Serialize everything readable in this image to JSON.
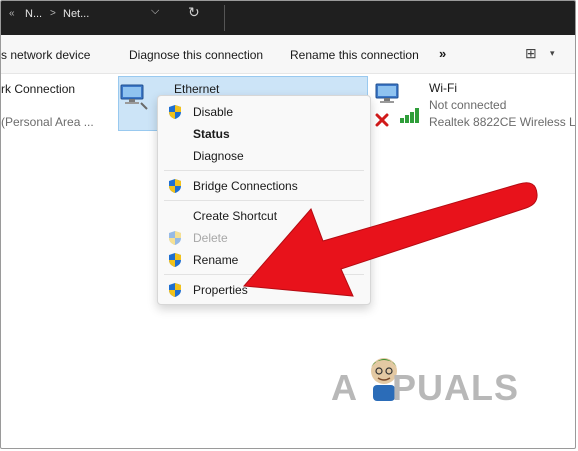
{
  "breadcrumb": {
    "back": "«",
    "seg1": "N...",
    "sep": ">",
    "seg2": "Net...",
    "chevron": "⌵",
    "refresh": "↻"
  },
  "commands": {
    "rename_device_partial": "s network device",
    "diagnose": "Diagnose this connection",
    "rename_connection": "Rename this connection",
    "more": "»",
    "view": "⊞",
    "view_dropdown": "▾"
  },
  "connections": {
    "left": {
      "name": "rk Connection",
      "subtitle": "(Personal Area ..."
    },
    "ethernet": {
      "name": "Ethernet"
    },
    "wifi": {
      "name": "Wi-Fi",
      "status": "Not connected",
      "adapter": "Realtek 8822CE Wireless L..."
    }
  },
  "context_menu": {
    "items": [
      {
        "label": "Disable",
        "shield": true,
        "style": "normal"
      },
      {
        "label": "Status",
        "shield": false,
        "style": "bold"
      },
      {
        "label": "Diagnose",
        "shield": false,
        "style": "normal"
      },
      {
        "label": "Bridge Connections",
        "shield": true,
        "style": "normal"
      },
      {
        "label": "Create Shortcut",
        "shield": false,
        "style": "normal"
      },
      {
        "label": "Delete",
        "shield": true,
        "style": "disabled"
      },
      {
        "label": "Rename",
        "shield": true,
        "style": "normal"
      },
      {
        "label": "Properties",
        "shield": true,
        "style": "normal"
      }
    ]
  },
  "watermark": {
    "left": "A",
    "right": "PUALS"
  },
  "colors": {
    "arrow": "#e8121b",
    "selection": "#cce4f7",
    "shield_blue": "#1f6fd1",
    "shield_yellow": "#f2c21b"
  },
  "icons": {
    "ethernet": "network-computer-icon",
    "wifi": "network-computer-icon",
    "disconnected": "red-x-icon",
    "signal": "signal-bars-icon",
    "shield": "uac-shield-icon"
  }
}
